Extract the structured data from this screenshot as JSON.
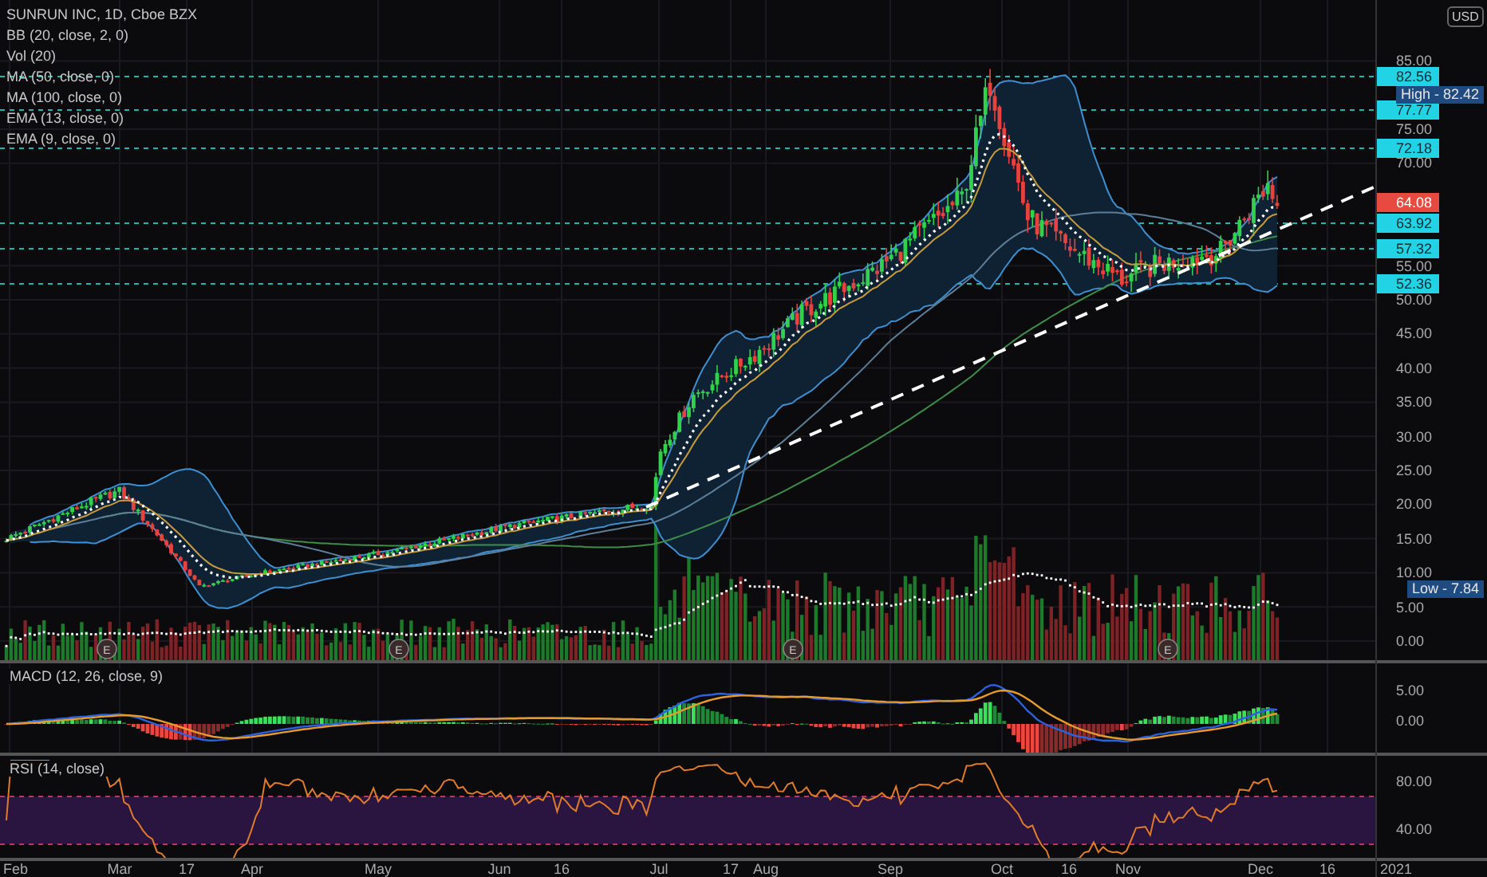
{
  "legend": {
    "title": "SUNRUN INC, 1D, Cboe BZX",
    "indicators": [
      "BB (20, close, 2, 0)",
      "Vol (20)",
      "MA (50, close, 0)",
      "MA (100, close, 0)",
      "EMA (13, close, 0)",
      "EMA (9, close, 0)"
    ]
  },
  "price_axis": {
    "currency": "USD",
    "ticks": [
      "85.00",
      "75.00",
      "70.00",
      "55.00",
      "50.00",
      "45.00",
      "40.00",
      "35.00",
      "30.00",
      "25.00",
      "20.00",
      "15.00",
      "10.00",
      "5.00",
      "0.00"
    ]
  },
  "price_levels": [
    {
      "label": "82.56",
      "kind": "level"
    },
    {
      "label": "77.77",
      "kind": "level"
    },
    {
      "label": "72.18",
      "kind": "level"
    },
    {
      "label": "64.08",
      "kind": "last"
    },
    {
      "label": "63.92",
      "kind": "level"
    },
    {
      "label": "57.32",
      "kind": "level"
    },
    {
      "label": "52.36",
      "kind": "level"
    }
  ],
  "high_marker": "High - 82.42",
  "low_marker": "Low - 7.84",
  "earnings_markers": [
    "E",
    "E",
    "E",
    "E"
  ],
  "macd": {
    "label": "MACD (12, 26, close, 9)",
    "ticks": [
      "5.00",
      "0.00"
    ]
  },
  "rsi": {
    "label": "RSI (14, close)",
    "ticks": [
      "80.00",
      "40.00"
    ]
  },
  "time_axis": {
    "labels": [
      "Feb",
      "Mar",
      "17",
      "Apr",
      "May",
      "Jun",
      "16",
      "Jul",
      "17",
      "Aug",
      "Sep",
      "Oct",
      "16",
      "Nov",
      "Dec",
      "16",
      "2021"
    ]
  }
}
